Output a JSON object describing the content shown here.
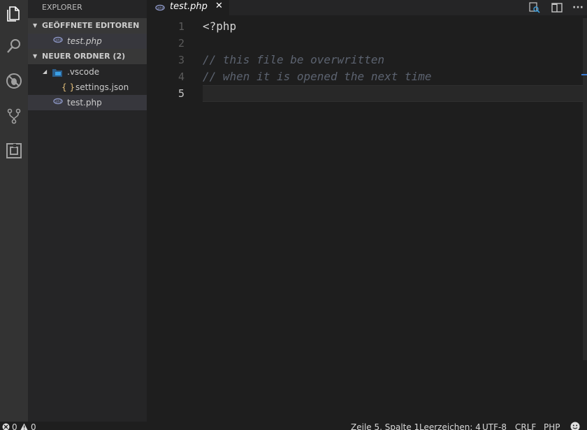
{
  "sidebar": {
    "title": "EXPLORER",
    "open_editors_header": "GEÖFFNETE EDITOREN",
    "open_editors": [
      {
        "label": "test.php",
        "icon": "php-file-icon"
      }
    ],
    "folder_header": "NEUER ORDNER (2)",
    "tree": [
      {
        "label": ".vscode",
        "icon": "vscode-folder-icon"
      },
      {
        "label": "settings.json",
        "icon": "json-file-icon"
      },
      {
        "label": "test.php",
        "icon": "php-file-icon"
      }
    ]
  },
  "tabs": [
    {
      "label": "test.php",
      "close": "✕"
    }
  ],
  "editor": {
    "lines": [
      {
        "num": "1",
        "text": "<?php"
      },
      {
        "num": "2",
        "text": ""
      },
      {
        "num": "3",
        "text": "// this file be overwritten"
      },
      {
        "num": "4",
        "text": "// when it is opened the next time"
      },
      {
        "num": "5",
        "text": ""
      }
    ]
  },
  "activity_bar": [
    "explorer-icon",
    "search-icon",
    "debug-icon",
    "source-control-icon",
    "extensions-icon"
  ],
  "top_actions": [
    "open-changes-icon",
    "split-editor-icon",
    "more-actions-icon"
  ],
  "top_actions_more": "···",
  "status": {
    "errors": "0",
    "warnings": "0",
    "position": "Zeile 5, Spalte 1",
    "indent": "Leerzeichen: 4",
    "encoding": "UTF-8",
    "eol": "CRLF",
    "language": "PHP"
  },
  "colors": {
    "background": "#1e1e1e",
    "sidebar": "#252526",
    "activity_bar": "#333333",
    "comment": "#608b4e",
    "php_tag": "#d4d4d4"
  }
}
